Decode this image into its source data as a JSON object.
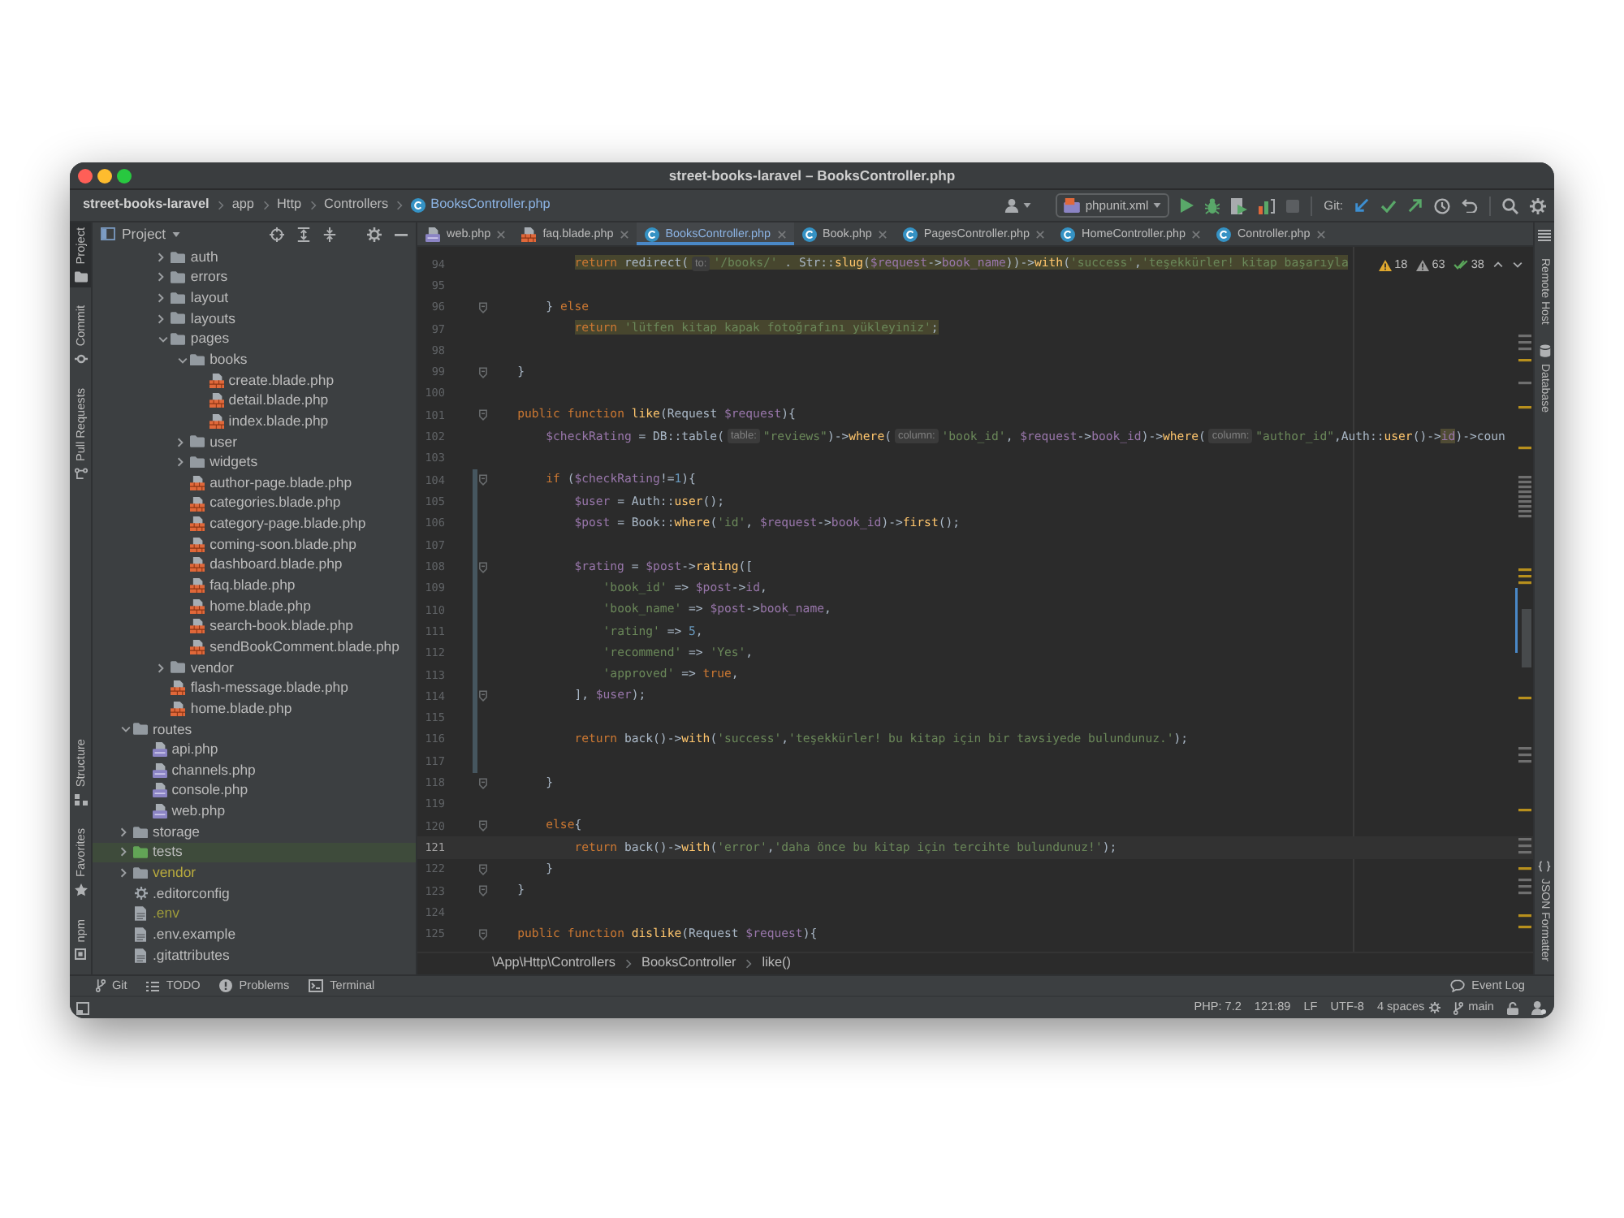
{
  "window": {
    "title": "street-books-laravel – BooksController.php"
  },
  "navigation_bar": {
    "breadcrumbs": [
      {
        "label": "street-books-laravel",
        "kind": "project"
      },
      {
        "label": "app",
        "kind": "folder"
      },
      {
        "label": "Http",
        "kind": "folder"
      },
      {
        "label": "Controllers",
        "kind": "folder"
      },
      {
        "label": "BooksController.php",
        "kind": "class"
      }
    ],
    "run_configuration": "phpunit.xml",
    "vcs_label": "Git:"
  },
  "tool_strip_left": {
    "top": [
      {
        "label": "Project",
        "kind": "project",
        "selected": true
      },
      {
        "label": "Commit",
        "kind": "commit",
        "selected": false
      },
      {
        "label": "Pull Requests",
        "kind": "pullrequests",
        "selected": false
      }
    ],
    "bottom": [
      {
        "label": "Structure",
        "kind": "structure",
        "selected": false
      },
      {
        "label": "Favorites",
        "kind": "favorites",
        "selected": false
      },
      {
        "label": "npm",
        "kind": "npm",
        "selected": false
      }
    ]
  },
  "project_panel": {
    "title": "Project",
    "tree": [
      {
        "children": [
          {
            "children": [
              {
                "label": "auth",
                "kind": "folder",
                "expanded": false
              },
              {
                "label": "errors",
                "kind": "folder",
                "expanded": false
              },
              {
                "label": "layout",
                "kind": "folder",
                "expanded": false
              },
              {
                "label": "layouts",
                "kind": "folder",
                "expanded": false
              },
              {
                "label": "pages",
                "kind": "folder",
                "expanded": true,
                "children": [
                  {
                    "label": "books",
                    "kind": "folder",
                    "expanded": true,
                    "children": [
                      {
                        "label": "create.blade.php",
                        "kind": "blade"
                      },
                      {
                        "label": "detail.blade.php",
                        "kind": "blade"
                      },
                      {
                        "label": "index.blade.php",
                        "kind": "blade"
                      }
                    ]
                  },
                  {
                    "label": "user",
                    "kind": "folder",
                    "expanded": false
                  },
                  {
                    "label": "widgets",
                    "kind": "folder",
                    "expanded": false
                  },
                  {
                    "label": "author-page.blade.php",
                    "kind": "blade"
                  },
                  {
                    "label": "categories.blade.php",
                    "kind": "blade"
                  },
                  {
                    "label": "category-page.blade.php",
                    "kind": "blade"
                  },
                  {
                    "label": "coming-soon.blade.php",
                    "kind": "blade"
                  },
                  {
                    "label": "dashboard.blade.php",
                    "kind": "blade"
                  },
                  {
                    "label": "faq.blade.php",
                    "kind": "blade"
                  },
                  {
                    "label": "home.blade.php",
                    "kind": "blade"
                  },
                  {
                    "label": "search-book.blade.php",
                    "kind": "blade"
                  },
                  {
                    "label": "sendBookComment.blade.php",
                    "kind": "blade"
                  }
                ]
              },
              {
                "label": "vendor",
                "kind": "folder",
                "expanded": false
              },
              {
                "label": "flash-message.blade.php",
                "kind": "blade"
              },
              {
                "label": "home.blade.php",
                "kind": "blade"
              }
            ]
          }
        ]
      },
      {
        "label": "routes",
        "kind": "folder",
        "expanded": true,
        "children": [
          {
            "label": "api.php",
            "kind": "php"
          },
          {
            "label": "channels.php",
            "kind": "php"
          },
          {
            "label": "console.php",
            "kind": "php"
          },
          {
            "label": "web.php",
            "kind": "php"
          }
        ]
      },
      {
        "label": "storage",
        "kind": "folder",
        "expanded": false
      },
      {
        "label": "tests",
        "kind": "testroot",
        "expanded": false
      },
      {
        "label": "vendor",
        "kind": "library",
        "expanded": false
      },
      {
        "label": ".editorconfig",
        "kind": "config"
      },
      {
        "label": ".env",
        "kind": "ignored"
      },
      {
        "label": ".env.example",
        "kind": "text"
      },
      {
        "label": ".gitattributes",
        "kind": "text"
      }
    ]
  },
  "tabs": [
    {
      "label": "web.php",
      "kind": "php",
      "selected": false,
      "modified": false
    },
    {
      "label": "faq.blade.php",
      "kind": "blade",
      "selected": false,
      "modified": false
    },
    {
      "label": "BooksController.php",
      "kind": "class",
      "selected": true,
      "modified": true
    },
    {
      "label": "Book.php",
      "kind": "class",
      "selected": false,
      "modified": false
    },
    {
      "label": "PagesController.php",
      "kind": "class",
      "selected": false,
      "modified": false
    },
    {
      "label": "HomeController.php",
      "kind": "class",
      "selected": false,
      "modified": false
    },
    {
      "label": "Controller.php",
      "kind": "class",
      "selected": false,
      "modified": false
    }
  ],
  "inspection_widget": [
    {
      "kind": "warning",
      "count": "18"
    },
    {
      "kind": "weak",
      "count": "63"
    },
    {
      "kind": "typo",
      "count": "38"
    }
  ],
  "editor": {
    "lines": [
      {
        "number": "94",
        "kind": "warning",
        "changed": false,
        "fold": false,
        "tokens": [
          {
            "kind": "keyword",
            "text": "            return"
          },
          {
            "kind": "plain",
            "text": " redirect("
          },
          {
            "kind": "hint",
            "text": "to:"
          },
          {
            "kind": "string",
            "text": "'/books/'"
          },
          {
            "kind": "plain",
            "text": " . Str::"
          },
          {
            "kind": "method",
            "text": "slug"
          },
          {
            "kind": "plain",
            "text": "("
          },
          {
            "kind": "variable",
            "text": "$request"
          },
          {
            "kind": "plain",
            "text": "->"
          },
          {
            "kind": "property",
            "text": "book_name"
          },
          {
            "kind": "plain",
            "text": "))->"
          },
          {
            "kind": "method",
            "text": "with"
          },
          {
            "kind": "plain",
            "text": "("
          },
          {
            "kind": "string",
            "text": "'success'"
          },
          {
            "kind": "plain",
            "text": ","
          },
          {
            "kind": "string",
            "text": "'teşekkürler! kitap başarıyla"
          }
        ]
      },
      {
        "number": "95",
        "kind": "normal",
        "changed": false,
        "fold": false
      },
      {
        "number": "96",
        "kind": "normal",
        "changed": false,
        "fold": true,
        "tokens": [
          {
            "kind": "plain",
            "text": "        }"
          },
          {
            "kind": "keyword",
            "text": " else"
          }
        ]
      },
      {
        "number": "97",
        "kind": "warning",
        "changed": false,
        "fold": false,
        "tokens": [
          {
            "kind": "keyword",
            "text": "            return "
          },
          {
            "kind": "string",
            "text": "'lütfen kitap kapak fotoğrafını yükleyiniz'"
          },
          {
            "kind": "plain",
            "text": ";"
          }
        ]
      },
      {
        "number": "98",
        "kind": "normal",
        "changed": false,
        "fold": false
      },
      {
        "number": "99",
        "kind": "normal",
        "changed": false,
        "fold": true,
        "tokens": [
          {
            "kind": "plain",
            "text": "    }"
          }
        ]
      },
      {
        "number": "100",
        "kind": "normal",
        "changed": false,
        "fold": false
      },
      {
        "number": "101",
        "kind": "normal",
        "changed": false,
        "fold": true,
        "tokens": [
          {
            "kind": "keyword",
            "text": "    public function "
          },
          {
            "kind": "method",
            "text": "like"
          },
          {
            "kind": "plain",
            "text": "(Request "
          },
          {
            "kind": "variable",
            "text": "$request"
          },
          {
            "kind": "plain",
            "text": "){"
          }
        ]
      },
      {
        "number": "102",
        "kind": "normal",
        "changed": false,
        "fold": false,
        "tokens": [
          {
            "kind": "variable",
            "text": "        $checkRating"
          },
          {
            "kind": "plain",
            "text": " = DB::table("
          },
          {
            "kind": "hint",
            "text": "table:"
          },
          {
            "kind": "string",
            "text": "\"reviews\""
          },
          {
            "kind": "plain",
            "text": ")->"
          },
          {
            "kind": "method",
            "text": "where"
          },
          {
            "kind": "plain",
            "text": "("
          },
          {
            "kind": "hint",
            "text": "column:"
          },
          {
            "kind": "string",
            "text": "'book_id'"
          },
          {
            "kind": "plain",
            "text": ", "
          },
          {
            "kind": "variable",
            "text": "$request"
          },
          {
            "kind": "plain",
            "text": "->"
          },
          {
            "kind": "property",
            "text": "book_id"
          },
          {
            "kind": "plain",
            "text": ")->"
          },
          {
            "kind": "method",
            "text": "where"
          },
          {
            "kind": "plain",
            "text": "("
          },
          {
            "kind": "hint",
            "text": "column:"
          },
          {
            "kind": "string",
            "text": "\"author_id\""
          },
          {
            "kind": "plain",
            "text": ",Auth::"
          },
          {
            "kind": "method",
            "text": "user"
          },
          {
            "kind": "plain",
            "text": "()->"
          },
          {
            "kind": "match",
            "text": "id"
          },
          {
            "kind": "plain",
            "text": ")->coun"
          }
        ]
      },
      {
        "number": "103",
        "kind": "normal",
        "changed": false,
        "fold": false
      },
      {
        "number": "104",
        "kind": "normal",
        "changed": true,
        "fold": true,
        "tokens": [
          {
            "kind": "keyword",
            "text": "        if"
          },
          {
            "kind": "plain",
            "text": " ("
          },
          {
            "kind": "variable",
            "text": "$checkRating"
          },
          {
            "kind": "plain",
            "text": "!="
          },
          {
            "kind": "number",
            "text": "1"
          },
          {
            "kind": "plain",
            "text": "){"
          }
        ]
      },
      {
        "number": "105",
        "kind": "normal",
        "changed": true,
        "fold": false,
        "tokens": [
          {
            "kind": "variable",
            "text": "            $user"
          },
          {
            "kind": "plain",
            "text": " = Auth::"
          },
          {
            "kind": "method",
            "text": "user"
          },
          {
            "kind": "plain",
            "text": "();"
          }
        ]
      },
      {
        "number": "106",
        "kind": "normal",
        "changed": true,
        "fold": false,
        "tokens": [
          {
            "kind": "variable",
            "text": "            $post"
          },
          {
            "kind": "plain",
            "text": " = Book::"
          },
          {
            "kind": "method",
            "text": "where"
          },
          {
            "kind": "plain",
            "text": "("
          },
          {
            "kind": "string",
            "text": "'id'"
          },
          {
            "kind": "plain",
            "text": ", "
          },
          {
            "kind": "variable",
            "text": "$request"
          },
          {
            "kind": "plain",
            "text": "->"
          },
          {
            "kind": "property",
            "text": "book_id"
          },
          {
            "kind": "plain",
            "text": ")->"
          },
          {
            "kind": "method",
            "text": "first"
          },
          {
            "kind": "plain",
            "text": "();"
          }
        ]
      },
      {
        "number": "107",
        "kind": "normal",
        "changed": true,
        "fold": false
      },
      {
        "number": "108",
        "kind": "normal",
        "changed": true,
        "fold": true,
        "tokens": [
          {
            "kind": "variable",
            "text": "            $rating"
          },
          {
            "kind": "plain",
            "text": " = "
          },
          {
            "kind": "variable",
            "text": "$post"
          },
          {
            "kind": "plain",
            "text": "->"
          },
          {
            "kind": "method",
            "text": "rating"
          },
          {
            "kind": "plain",
            "text": "(["
          }
        ]
      },
      {
        "number": "109",
        "kind": "normal",
        "changed": true,
        "fold": false,
        "tokens": [
          {
            "kind": "string",
            "text": "                'book_id'"
          },
          {
            "kind": "plain",
            "text": " => "
          },
          {
            "kind": "variable",
            "text": "$post"
          },
          {
            "kind": "plain",
            "text": "->"
          },
          {
            "kind": "property",
            "text": "id"
          },
          {
            "kind": "plain",
            "text": ","
          }
        ]
      },
      {
        "number": "110",
        "kind": "normal",
        "changed": true,
        "fold": false,
        "tokens": [
          {
            "kind": "string",
            "text": "                'book_name'"
          },
          {
            "kind": "plain",
            "text": " => "
          },
          {
            "kind": "variable",
            "text": "$post"
          },
          {
            "kind": "plain",
            "text": "->"
          },
          {
            "kind": "property",
            "text": "book_name"
          },
          {
            "kind": "plain",
            "text": ","
          }
        ]
      },
      {
        "number": "111",
        "kind": "normal",
        "changed": true,
        "fold": false,
        "tokens": [
          {
            "kind": "string",
            "text": "                'rating'"
          },
          {
            "kind": "plain",
            "text": " => "
          },
          {
            "kind": "number",
            "text": "5"
          },
          {
            "kind": "plain",
            "text": ","
          }
        ]
      },
      {
        "number": "112",
        "kind": "normal",
        "changed": true,
        "fold": false,
        "tokens": [
          {
            "kind": "string",
            "text": "                'recommend'"
          },
          {
            "kind": "plain",
            "text": " => "
          },
          {
            "kind": "string",
            "text": "'Yes'"
          },
          {
            "kind": "plain",
            "text": ","
          }
        ]
      },
      {
        "number": "113",
        "kind": "normal",
        "changed": true,
        "fold": false,
        "tokens": [
          {
            "kind": "string",
            "text": "                'approved'"
          },
          {
            "kind": "plain",
            "text": " => "
          },
          {
            "kind": "keyword",
            "text": "true"
          },
          {
            "kind": "plain",
            "text": ","
          }
        ]
      },
      {
        "number": "114",
        "kind": "normal",
        "changed": true,
        "fold": true,
        "tokens": [
          {
            "kind": "plain",
            "text": "            ], "
          },
          {
            "kind": "variable",
            "text": "$user"
          },
          {
            "kind": "plain",
            "text": ");"
          }
        ]
      },
      {
        "number": "115",
        "kind": "normal",
        "changed": true,
        "fold": false
      },
      {
        "number": "116",
        "kind": "normal",
        "changed": true,
        "fold": false,
        "tokens": [
          {
            "kind": "keyword",
            "text": "            return"
          },
          {
            "kind": "plain",
            "text": " back()->"
          },
          {
            "kind": "method",
            "text": "with"
          },
          {
            "kind": "plain",
            "text": "("
          },
          {
            "kind": "string",
            "text": "'success'"
          },
          {
            "kind": "plain",
            "text": ","
          },
          {
            "kind": "string",
            "text": "'teşekkürler! bu kitap için bir tavsiyede bulundunuz.'"
          },
          {
            "kind": "plain",
            "text": ");"
          }
        ]
      },
      {
        "number": "117",
        "kind": "normal",
        "changed": true,
        "fold": false
      },
      {
        "number": "118",
        "kind": "normal",
        "changed": false,
        "fold": true,
        "tokens": [
          {
            "kind": "plain",
            "text": "        }"
          }
        ]
      },
      {
        "number": "119",
        "kind": "normal",
        "changed": false,
        "fold": false
      },
      {
        "number": "120",
        "kind": "normal",
        "changed": false,
        "fold": true,
        "tokens": [
          {
            "kind": "keyword",
            "text": "        else"
          },
          {
            "kind": "plain",
            "text": "{"
          }
        ]
      },
      {
        "number": "121",
        "kind": "current",
        "changed": false,
        "fold": false,
        "tokens": [
          {
            "kind": "keyword",
            "text": "            return"
          },
          {
            "kind": "plain",
            "text": " back()->"
          },
          {
            "kind": "method",
            "text": "with"
          },
          {
            "kind": "plain",
            "text": "("
          },
          {
            "kind": "string",
            "text": "'error'"
          },
          {
            "kind": "plain",
            "text": ","
          },
          {
            "kind": "string",
            "text": "'daha önce bu kitap için tercihte bulundunuz!'"
          },
          {
            "kind": "plain",
            "text": ");"
          }
        ]
      },
      {
        "number": "122",
        "kind": "normal",
        "changed": false,
        "fold": true,
        "tokens": [
          {
            "kind": "plain",
            "text": "        }"
          }
        ]
      },
      {
        "number": "123",
        "kind": "normal",
        "changed": false,
        "fold": true,
        "tokens": [
          {
            "kind": "plain",
            "text": "    }"
          }
        ]
      },
      {
        "number": "124",
        "kind": "normal",
        "changed": false,
        "fold": false
      },
      {
        "number": "125",
        "kind": "normal",
        "changed": false,
        "fold": true,
        "tokens": [
          {
            "kind": "keyword",
            "text": "    public function "
          },
          {
            "kind": "method",
            "text": "dislike"
          },
          {
            "kind": "plain",
            "text": "(Request "
          },
          {
            "kind": "variable",
            "text": "$request"
          },
          {
            "kind": "plain",
            "text": "){"
          }
        ]
      }
    ]
  },
  "editor_breadcrumbs": [
    "\\App\\Http\\Controllers",
    "BooksController",
    "like()"
  ],
  "tool_strip_right": {
    "top": [
      {
        "label": "Remote Host",
        "kind": "plain"
      },
      {
        "label": "Database",
        "kind": "database"
      }
    ],
    "bottom": [
      {
        "label": "JSON Formatter",
        "kind": "json"
      }
    ]
  },
  "tool_window_bar": {
    "left": [
      {
        "label": "Git",
        "kind": "git"
      },
      {
        "label": "TODO",
        "kind": "todo"
      },
      {
        "label": "Problems",
        "kind": "problems"
      },
      {
        "label": "Terminal",
        "kind": "terminal"
      }
    ],
    "right": [
      {
        "label": "Event Log",
        "kind": "log"
      }
    ]
  },
  "status_bar": {
    "items": [
      {
        "label": "PHP: 7.2",
        "kind": "plain"
      },
      {
        "label": "121:89",
        "kind": "plain"
      },
      {
        "label": "LF",
        "kind": "plain"
      },
      {
        "label": "UTF-8",
        "kind": "plain"
      },
      {
        "label": "4 spaces",
        "kind": "indent"
      },
      {
        "label": "main",
        "kind": "branch"
      }
    ]
  }
}
